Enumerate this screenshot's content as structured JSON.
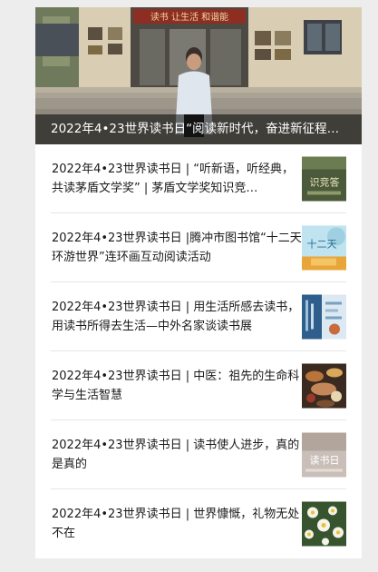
{
  "hero": {
    "caption": "2022年4•23世界读书日“阅读新时代，奋进新征程…",
    "sign_text": "读书 让生活 和谐能"
  },
  "articles": [
    {
      "title": "2022年4•23世界读书日 | “听新语，听经典，共读茅盾文学奖” | 茅盾文学奖知识竞…",
      "thumb_icon": "quiz-poster-icon",
      "thumb_text": "识竞答"
    },
    {
      "title": "2022年4•23世界读书日 |腾冲市图书馆“十二天环游世界”连环画互动阅读活动",
      "thumb_icon": "world-tour-poster-icon",
      "thumb_text": "十二天"
    },
    {
      "title": "2022年4•23世界读书日 | 用生活所感去读书，用读书所得去生活—中外名家谈读书展",
      "thumb_icon": "exhibition-poster-icon",
      "thumb_text": ""
    },
    {
      "title": "2022年4•23世界读书日 |  中医：祖先的生命科学与生活智慧",
      "thumb_icon": "herbal-medicine-icon",
      "thumb_text": ""
    },
    {
      "title": "2022年4•23世界读书日 | 读书使人进步，真的是真的",
      "thumb_icon": "reading-day-poster-icon",
      "thumb_text": "读书日"
    },
    {
      "title": "2022年4•23世界读书日 | 世界慷慨，礼物无处不在",
      "thumb_icon": "flowers-photo-icon",
      "thumb_text": ""
    }
  ],
  "colors": {
    "background": "#ededed",
    "card": "#ffffff",
    "text": "#1a1a1a",
    "divider": "#e6e6e6"
  }
}
